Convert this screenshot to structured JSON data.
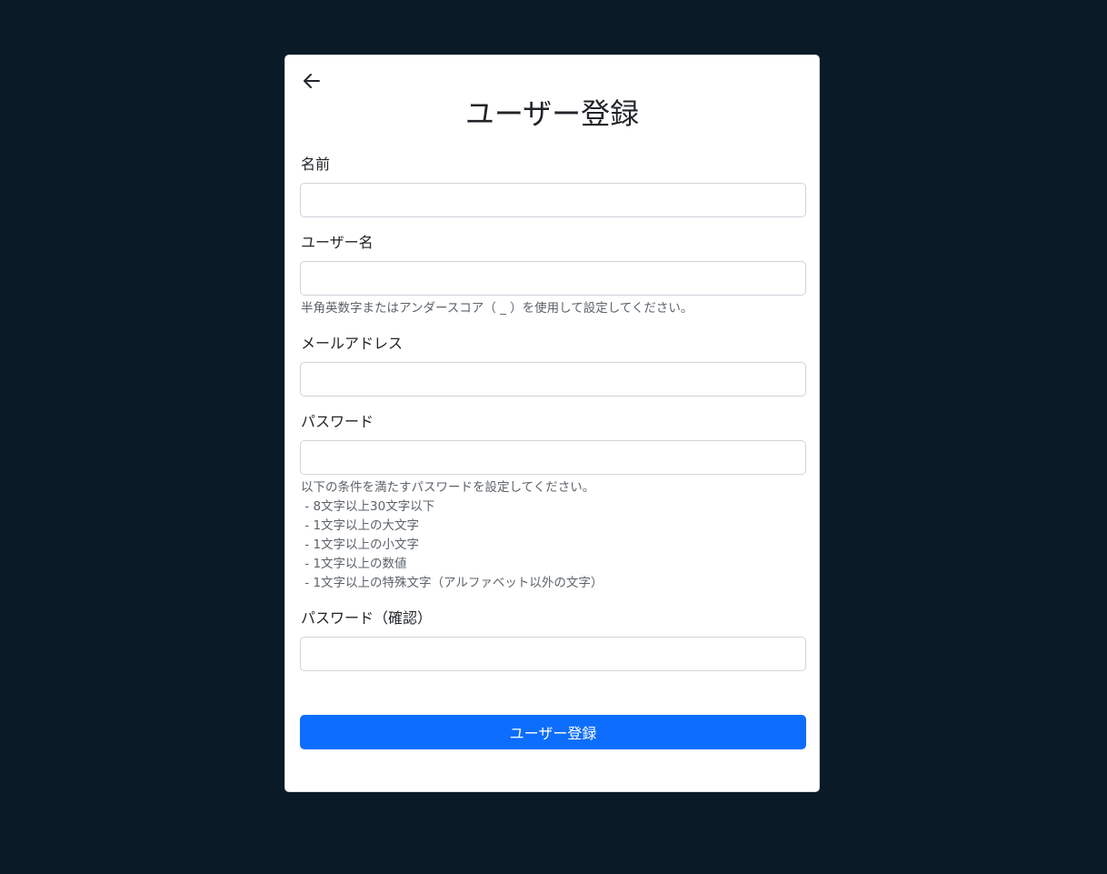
{
  "header": {
    "back_icon": "arrow-left-icon",
    "title": "ユーザー登録"
  },
  "form": {
    "name": {
      "label": "名前",
      "value": "",
      "placeholder": ""
    },
    "username": {
      "label": "ユーザー名",
      "value": "",
      "placeholder": "",
      "help": "半角英数字またはアンダースコア（ _ ）を使用して設定してください。"
    },
    "email": {
      "label": "メールアドレス",
      "value": "",
      "placeholder": ""
    },
    "password": {
      "label": "パスワード",
      "value": "",
      "placeholder": "",
      "help_intro": "以下の条件を満たすパスワードを設定してください。",
      "rules": [
        " - 8文字以上30文字以下",
        " - 1文字以上の大文字",
        " - 1文字以上の小文字",
        " - 1文字以上の数値",
        " - 1文字以上の特殊文字（アルファベット以外の文字）"
      ]
    },
    "password_confirm": {
      "label": "パスワード（確認）",
      "value": "",
      "placeholder": ""
    },
    "submit_label": "ユーザー登録"
  },
  "colors": {
    "background": "#0a1a26",
    "primary": "#0d6efd"
  }
}
